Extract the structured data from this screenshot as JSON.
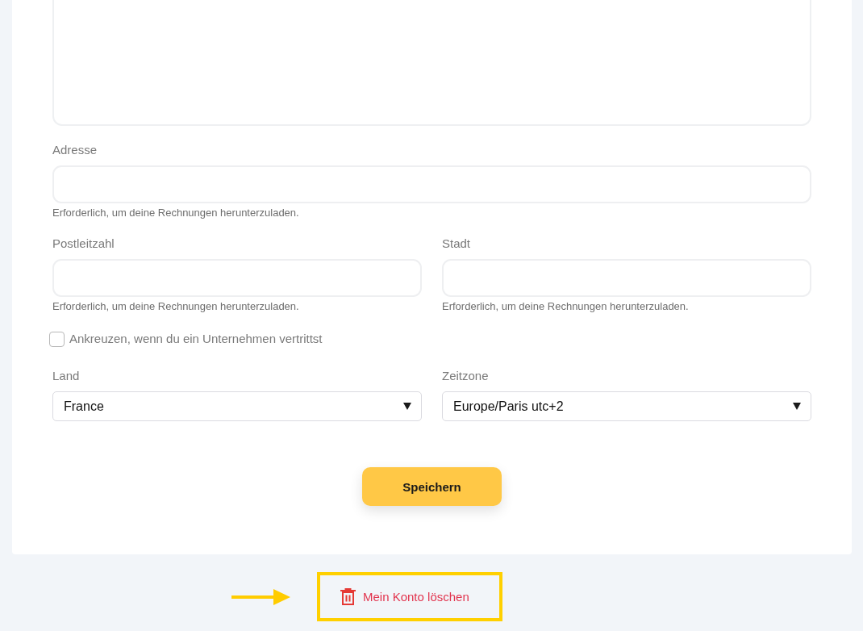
{
  "form": {
    "rows": [
      [
        {
          "kind": "textarea"
        }
      ],
      [
        {
          "kind": "text",
          "label": "Adresse",
          "hint": "Erforderlich, um deine Rechnungen herunterzuladen."
        }
      ],
      [
        {
          "kind": "text",
          "label": "Postleitzahl",
          "hint": "Erforderlich, um deine Rechnungen herunterzuladen."
        },
        {
          "kind": "text",
          "label": "Stadt",
          "hint": "Erforderlich, um deine Rechnungen herunterzuladen."
        }
      ],
      [
        {
          "kind": "checkbox",
          "label": "Ankreuzen, wenn du ein Unternehmen vertrittst",
          "checked": false
        }
      ],
      [
        {
          "kind": "select",
          "label": "Land",
          "value": "France"
        },
        {
          "kind": "select",
          "label": "Zeitzone",
          "value": "Europe/Paris utc+2"
        }
      ]
    ],
    "submit": "Speichern"
  },
  "delete_account": {
    "label": "Mein Konto löschen",
    "highlighted": true
  }
}
